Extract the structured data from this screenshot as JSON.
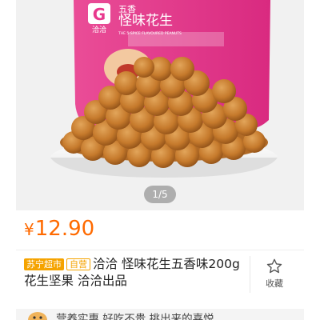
{
  "product_image": {
    "brand_logo_text": "洽洽",
    "package_title": "怪味花生",
    "package_small": "五香",
    "package_tagline": "THE 5-SPICE FLAVOURED PEANUTS",
    "pager": "1/5"
  },
  "price": {
    "symbol": "¥",
    "amount": "12.90"
  },
  "product": {
    "badge_store": "苏宁超市",
    "badge_self": "自营",
    "title": "洽洽 怪味花生五香味200g 花生坚果 洽洽出品"
  },
  "favorite": {
    "label": "收藏",
    "icon": "star-outline-icon"
  },
  "bottom_banner": {
    "text": "营养实惠 好吃不贵 挑出来的喜悦"
  },
  "colors": {
    "price": "#ff6a00",
    "badge": "#f5a300",
    "package_pink": "#e8388d"
  }
}
